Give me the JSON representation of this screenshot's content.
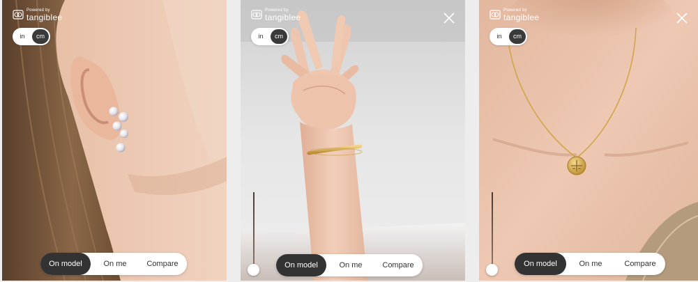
{
  "brand": {
    "powered": "Powered by",
    "name": "tangiblee"
  },
  "unit_toggle": {
    "in": "in",
    "cm": "cm",
    "selected": "cm"
  },
  "view_switch": {
    "on_model": "On model",
    "on_me": "On me",
    "compare": "Compare",
    "selected": "On model"
  },
  "panels": [
    {
      "product": "pearl earring",
      "close_visible": false,
      "slider_visible": false
    },
    {
      "product": "gold bangle bracelet",
      "close_visible": true,
      "slider_visible": true,
      "slider_level": 1.0
    },
    {
      "product": "gold zodiac pendant necklace",
      "close_visible": true,
      "slider_visible": true,
      "slider_level": 1.0
    }
  ],
  "colors": {
    "toggle_active": "#3a3a3a",
    "switch_active": "#333333",
    "skin": "#e9c5ad",
    "gold": "#d4a94a",
    "hair": "#7a5a3e"
  }
}
